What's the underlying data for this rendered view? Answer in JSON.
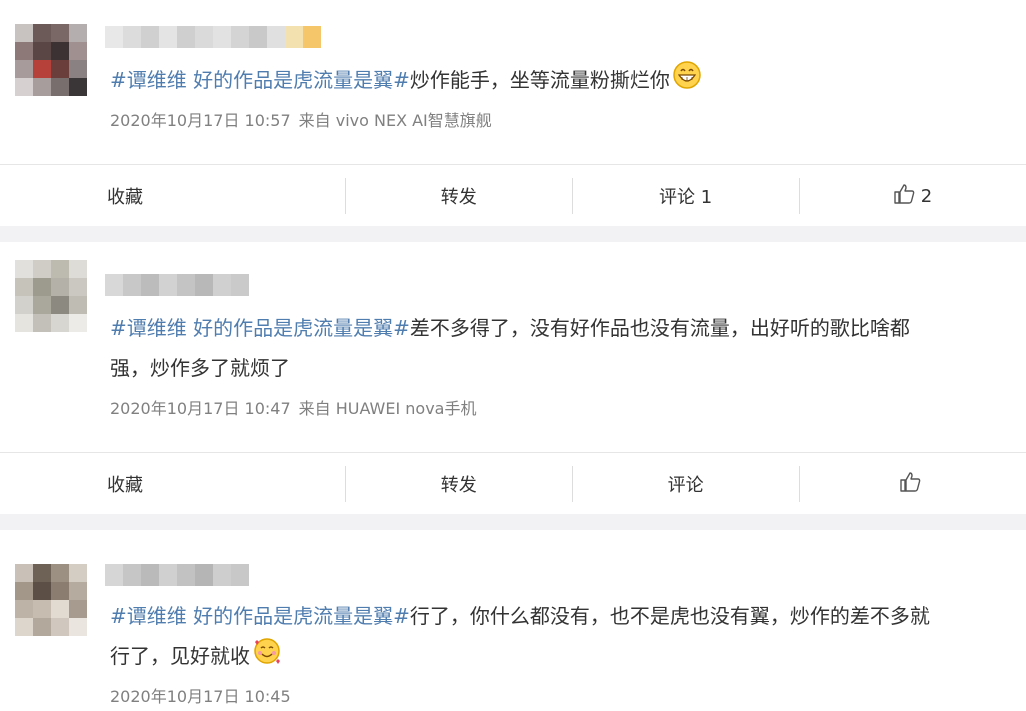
{
  "posts": [
    {
      "topic": "#谭维维 好的作品是虎流量是翼#",
      "text": "炒作能手，坐等流量粉撕烂你",
      "emoji": "grinning-face-emoji",
      "date": "2020年10月17日 10:57",
      "source": "来自 vivo NEX AI智慧旗舰",
      "actions": {
        "favorite": "收藏",
        "repost": "转发",
        "comment": "评论 1",
        "like": "2"
      }
    },
    {
      "topic": "#谭维维 好的作品是虎流量是翼#",
      "text": "差不多得了，没有好作品也没有流量，出好听的歌比啥都",
      "text2": "强，炒作多了就烦了",
      "date": "2020年10月17日 10:47",
      "source": "来自 HUAWEI nova手机",
      "actions": {
        "favorite": "收藏",
        "repost": "转发",
        "comment": "评论",
        "like": ""
      }
    },
    {
      "topic": "#谭维维 好的作品是虎流量是翼#",
      "text": "行了，你什么都没有，也不是虎也没有翼，炒作的差不多就",
      "text2": "行了，见好就收",
      "emoji": "smiling-face-with-hearts-emoji",
      "date": "2020年10月17日 10:45"
    }
  ]
}
